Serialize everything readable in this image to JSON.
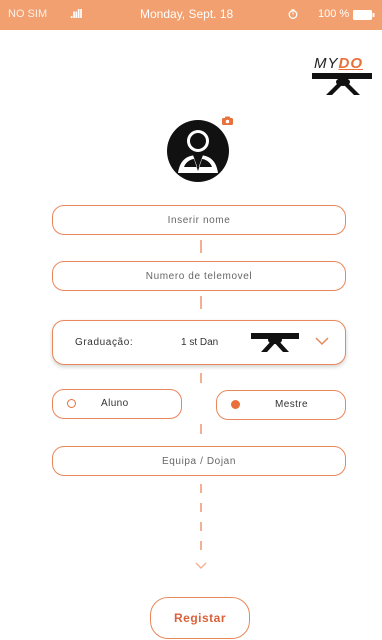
{
  "status_bar": {
    "carrier": "NO SIM",
    "signal": ".ııll",
    "date": "Monday, Sept. 18",
    "battery": "100 %"
  },
  "logo": {
    "my": "MY",
    "do": "DO"
  },
  "form": {
    "name_placeholder": "Inserir nome",
    "phone_placeholder": "Numero de telemovel",
    "graduation_label": "Graduação:",
    "graduation_value": "1 st Dan",
    "role_student": "Aluno",
    "role_master": "Mestre",
    "selected_role": "Mestre",
    "team_placeholder": "Equipa / Dojan",
    "register_label": "Registar"
  },
  "colors": {
    "accent": "#e8875a",
    "status_bar": "#f2a06f",
    "register_text": "#d9623a"
  },
  "icons": [
    "signal-icon",
    "clock-icon",
    "battery-icon",
    "avatar-icon",
    "camera-icon",
    "belt-icon",
    "chevron-down-icon"
  ]
}
